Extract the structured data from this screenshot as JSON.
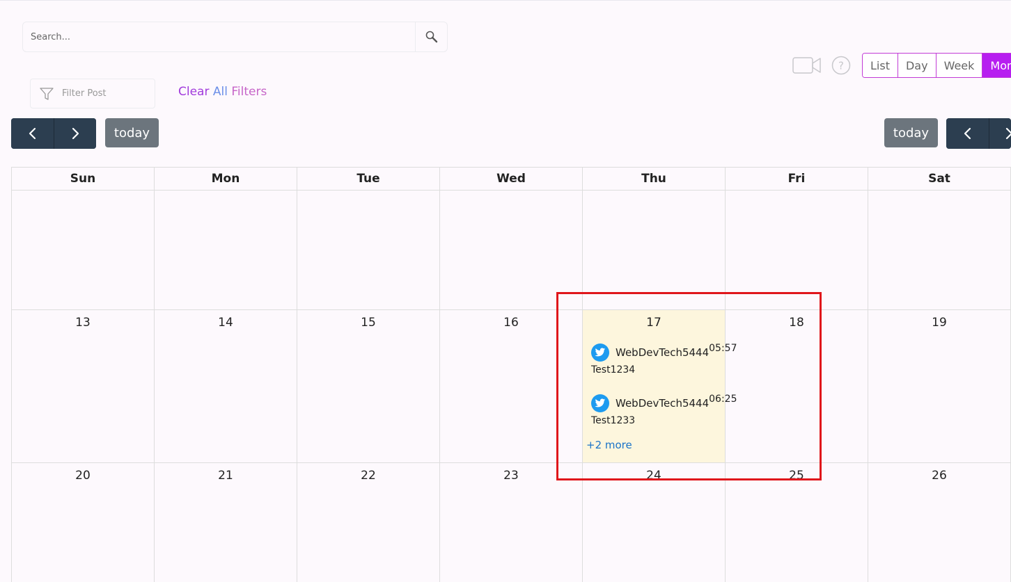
{
  "search": {
    "placeholder": "Search..."
  },
  "toolbar": {
    "views": [
      "List",
      "Day",
      "Week",
      "Mon"
    ],
    "active_view": "Mon",
    "filter_placeholder": "Filter Post",
    "clear_part1": "Clear",
    "clear_part2": "All",
    "clear_part3": "Filters",
    "today_label": "today"
  },
  "calendar": {
    "weekdays": [
      "Sun",
      "Mon",
      "Tue",
      "Wed",
      "Thu",
      "Fri",
      "Sat"
    ],
    "weeks": [
      [
        "",
        "",
        "",
        "",
        "",
        "",
        ""
      ],
      [
        "13",
        "14",
        "15",
        "16",
        "17",
        "18",
        "19"
      ],
      [
        "20",
        "21",
        "22",
        "23",
        "24",
        "25",
        "26"
      ]
    ],
    "events": [
      {
        "account": "WebDevTech5444",
        "time": "05:57",
        "text": "Test1234",
        "platform": "twitter-icon"
      },
      {
        "account": "WebDevTech5444",
        "time": "06:25",
        "text": "Test1233",
        "platform": "twitter-icon"
      }
    ],
    "more_label": "+2 more"
  },
  "colors": {
    "accent": "#b71ef0",
    "nav_dark": "#2c3e50",
    "today_gray": "#6c757d",
    "today_cell": "#fdf6dd",
    "twitter": "#1d9bf0",
    "highlight": "#e0161b"
  }
}
